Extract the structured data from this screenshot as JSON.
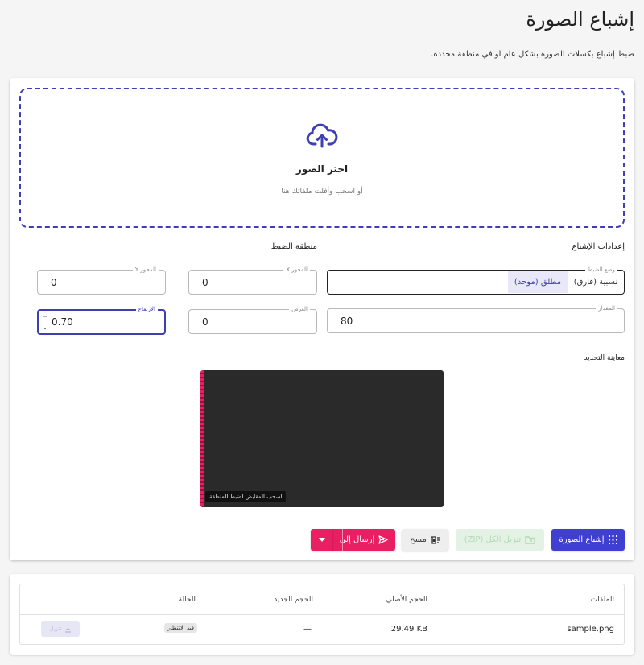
{
  "header": {
    "title": "إشباع الصورة",
    "subtitle": "ضبط إشباع بكسلات الصورة بشكل عام او في منطقة محددة."
  },
  "upload": {
    "title": "اختر الصور",
    "hint": "أو اسحب وأفلت ملفاتك هنا",
    "icon": "cloud-upload-icon"
  },
  "settings": {
    "heading": "إعدادات الإشباع",
    "mode_label": "وضع الضبط",
    "mode_options": [
      "نسبية (فارق)",
      "مطلق (موحد)"
    ],
    "mode_selected": "مطلق (موحد)",
    "amount_label": "المقدار",
    "amount_value": "80"
  },
  "region": {
    "heading": "منطقة الضبط",
    "x_label": "المحور X",
    "x_value": "0",
    "y_label": "المحور Y",
    "y_value": "0",
    "width_label": "العرض",
    "width_value": "0",
    "height_label": "الارتفاع",
    "height_value": "0.70"
  },
  "preview": {
    "heading": "معاينة التحديد",
    "hint": "اسحب المقابض لضبط المنطقة",
    "region_fraction": {
      "x": 0,
      "y": 0,
      "w": 0.01,
      "h": 1
    }
  },
  "actions": {
    "saturate": "إشباع الصورة",
    "download_zip": "تنزيل الكل (ZIP)",
    "clear": "مسح",
    "send_to": "إرسال إلى"
  },
  "table": {
    "headers": [
      "الملفات",
      "الحجم الأصلي",
      "الحجم الجديد",
      "الحالة"
    ],
    "rows": [
      {
        "name": "sample.png",
        "original": "29.49 KB",
        "new": "—",
        "status": "قيد الانتظار",
        "download": "تنزيل"
      }
    ]
  },
  "colors": {
    "primary": "#3f3fd0",
    "accent": "#e91e63",
    "success_disabled": "#e4f2e5"
  }
}
